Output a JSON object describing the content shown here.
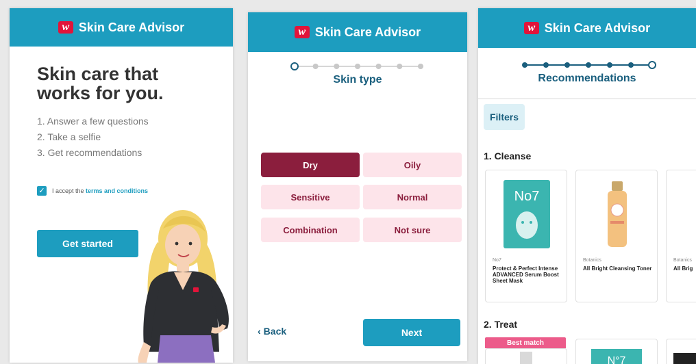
{
  "app": {
    "title": "Skin Care Advisor",
    "logo_letter": "w"
  },
  "intro": {
    "headline": "Skin care that works for you.",
    "steps": [
      "1. Answer a few questions",
      "2. Take a selfie",
      "3. Get recommendations"
    ],
    "terms_prefix": "I accept the ",
    "terms_link": "terms and conditions",
    "terms_checked": true,
    "cta": "Get started"
  },
  "skin_type": {
    "title": "Skin type",
    "progress_total": 7,
    "progress_current": 1,
    "options": [
      {
        "label": "Dry",
        "selected": true
      },
      {
        "label": "Oily",
        "selected": false
      },
      {
        "label": "Sensitive",
        "selected": false
      },
      {
        "label": "Normal",
        "selected": false
      },
      {
        "label": "Combination",
        "selected": false
      },
      {
        "label": "Not sure",
        "selected": false
      }
    ],
    "back": "Back",
    "next": "Next"
  },
  "recommendations": {
    "title": "Recommendations",
    "progress_total": 7,
    "progress_current": 7,
    "filters": "Filters",
    "sections": [
      {
        "title": "1. Cleanse",
        "products": [
          {
            "brand": "No7",
            "name": "Protect & Perfect Intense ADVANCED Serum Boost Sheet Mask",
            "image": "No7"
          },
          {
            "brand": "Botanics",
            "name": "All Bright Cleansing Toner",
            "image": ""
          },
          {
            "brand": "Botanics",
            "name": "All Brig",
            "image": ""
          }
        ]
      },
      {
        "title": "2. Treat",
        "badge": "Best match",
        "products": [
          {
            "image": ""
          },
          {
            "image": "N°7"
          },
          {
            "image": ""
          }
        ]
      }
    ]
  },
  "colors": {
    "primary": "#1d9dbf",
    "maroon": "#8b1e3d",
    "pink": "#fde4ea",
    "brand_red": "#e2143a",
    "badge": "#ec5b8a"
  }
}
